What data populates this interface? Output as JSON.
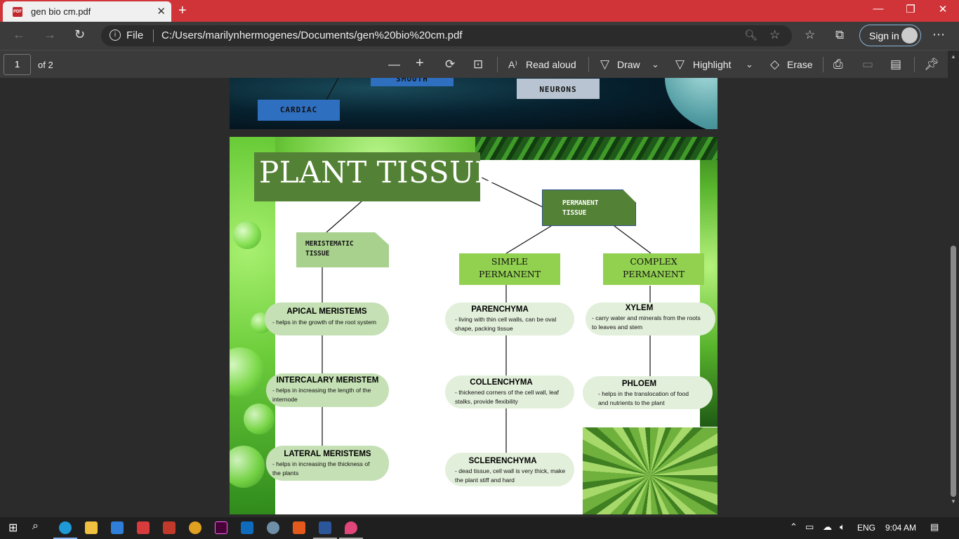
{
  "browser": {
    "tab_title": "gen bio cm.pdf",
    "address_prefix": "File",
    "url": "C:/Users/marilynhermogenes/Documents/gen%20bio%20cm.pdf",
    "sign_in_label": "Sign in"
  },
  "pdf_toolbar": {
    "page_number": "1",
    "page_count": "of 2",
    "read_aloud_label": "Read aloud",
    "draw_label": "Draw",
    "highlight_label": "Highlight",
    "erase_label": "Erase"
  },
  "page1_fragment": {
    "cardiac": "CARDIAC",
    "smooth": "SMOOTH",
    "neurons": "NEURONS"
  },
  "page2": {
    "title": "PLANT TISSUES",
    "permanent_tissue": [
      "PERMANENT",
      "TISSUE"
    ],
    "meristematic_tissue": [
      "MERISTEMATIC",
      "TISSUE"
    ],
    "simple_permanent": [
      "SIMPLE",
      "PERMANENT"
    ],
    "complex_permanent": [
      "COMPLEX",
      "PERMANENT"
    ],
    "meristematic_items": [
      {
        "name": "APICAL MERISTEMS",
        "desc": [
          "- helps in the growth of the root system"
        ]
      },
      {
        "name": "INTERCALARY MERISTEM",
        "desc": [
          "- helps in increasing the length of the",
          "internode"
        ]
      },
      {
        "name": "LATERAL MERISTEMS",
        "desc": [
          "- helps in increasing the thickness of",
          "the plants"
        ]
      }
    ],
    "simple_items": [
      {
        "name": "PARENCHYMA",
        "desc": [
          "- living with thin cell walls, can be oval",
          "shape, packing tissue"
        ]
      },
      {
        "name": "COLLENCHYMA",
        "desc": [
          "- thickened corners of the cell wall, leaf",
          "stalks, provide flexibility"
        ]
      },
      {
        "name": "SCLERENCHYMA",
        "desc": [
          "- dead tissue, cell wall is very thick, make",
          "the plant stiff and hard"
        ]
      }
    ],
    "complex_items": [
      {
        "name": "XYLEM",
        "desc": [
          "- carry water and minerals from the roots",
          "to leaves and stem"
        ]
      },
      {
        "name": "PHLOEM",
        "desc": [
          "- helps in the translocation of food",
          "and nutrients to the plant"
        ]
      }
    ]
  },
  "taskbar": {
    "language": "ENG",
    "time": "9:04 AM"
  },
  "colors": {
    "titlebar": "#d13438",
    "title_green": "#538135",
    "category_green": "#92d050",
    "pill_green": "#c5e0b4",
    "meristematic_box": "#a9d18e"
  }
}
